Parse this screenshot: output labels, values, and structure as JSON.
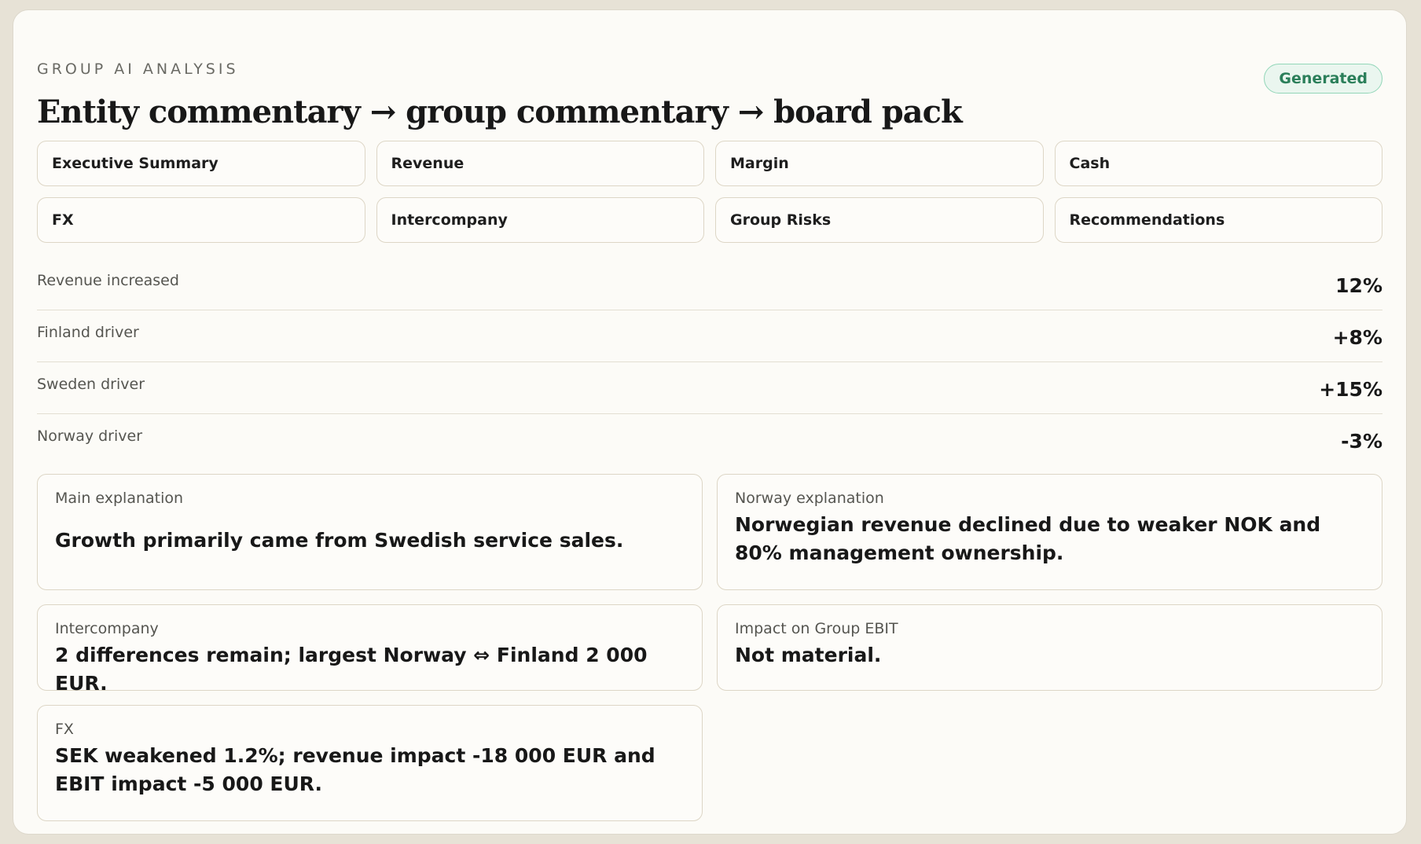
{
  "header": {
    "eyebrow": "GROUP AI ANALYSIS",
    "title": "Entity commentary → group commentary → board pack",
    "status_badge": "Generated"
  },
  "tabs": [
    {
      "label": "Executive Summary"
    },
    {
      "label": "Revenue"
    },
    {
      "label": "Margin"
    },
    {
      "label": "Cash"
    },
    {
      "label": "FX"
    },
    {
      "label": "Intercompany"
    },
    {
      "label": "Group Risks"
    },
    {
      "label": "Recommendations"
    }
  ],
  "metrics": [
    {
      "label": "Revenue increased",
      "value": "12%"
    },
    {
      "label": "Finland driver",
      "value": "+8%"
    },
    {
      "label": "Sweden driver",
      "value": "+15%"
    },
    {
      "label": "Norway driver",
      "value": "-3%"
    }
  ],
  "panels": {
    "main": {
      "label": "Main explanation",
      "text": "Growth primarily came from Swedish service sales."
    },
    "norway": {
      "label": "Norway explanation",
      "text": "Norwegian revenue declined due to weaker NOK and 80% management ownership."
    },
    "intercompany": {
      "label": "Intercompany",
      "text": "2 differences remain; largest Norway ⇔ Finland 2 000 EUR."
    },
    "ebit": {
      "label": "Impact on Group EBIT",
      "text": "Not material."
    },
    "fx": {
      "label": "FX",
      "text": "SEK weakened 1.2%; revenue impact -18 000 EUR and EBIT impact -5 000 EUR."
    }
  },
  "colors": {
    "background": "#e7e2d6",
    "card": "#fcfbf7",
    "badge_text": "#2b7f5a",
    "badge_border": "#92d6b8"
  }
}
